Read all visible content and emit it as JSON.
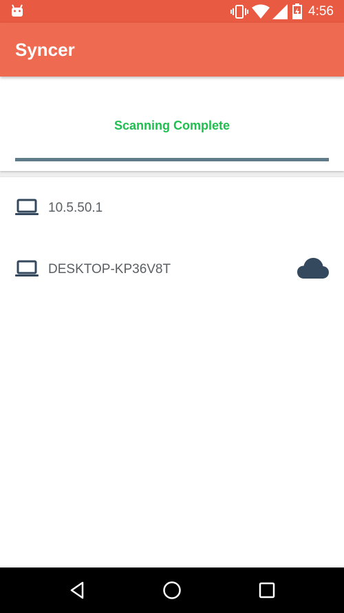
{
  "status_bar": {
    "time": "4:56",
    "icons": [
      "android-icon",
      "vibrate-icon",
      "wifi-icon",
      "signal-icon",
      "battery-icon"
    ]
  },
  "app_bar": {
    "title": "Syncer",
    "color": "#ee6b52"
  },
  "scan": {
    "status": "Scanning Complete",
    "status_color": "#1fbf4f",
    "progress": 1.0
  },
  "devices": [
    {
      "name": "10.5.50.1",
      "icon": "laptop-icon",
      "synced": false
    },
    {
      "name": "DESKTOP-KP36V8T",
      "icon": "laptop-icon",
      "synced": true,
      "sync_icon": "cloud-icon"
    }
  ],
  "nav_bar": {
    "buttons": [
      "back-icon",
      "home-icon",
      "recents-icon"
    ]
  }
}
